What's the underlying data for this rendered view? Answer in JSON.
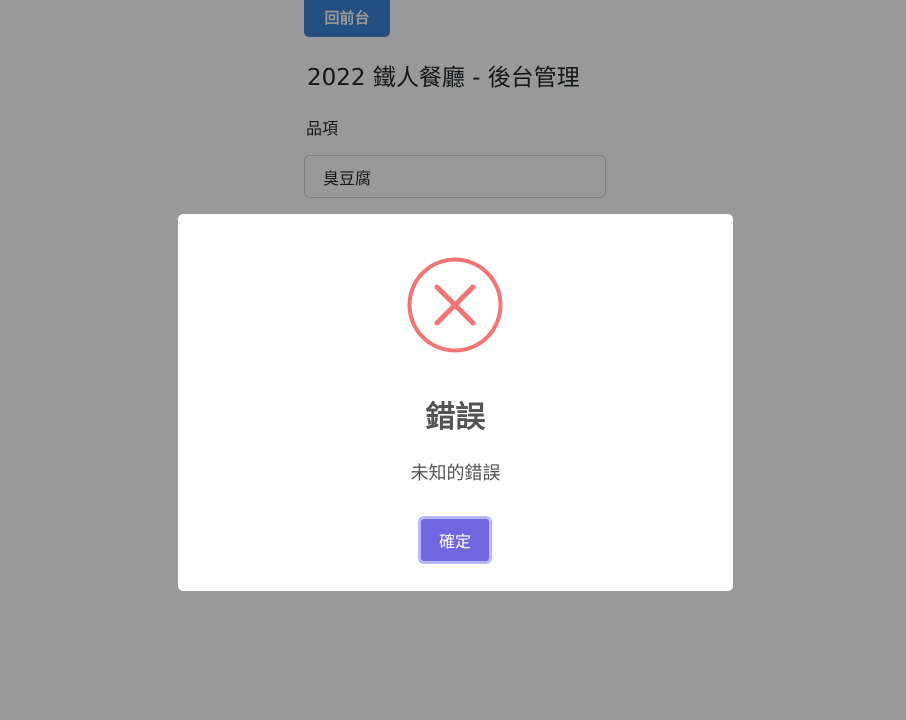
{
  "page": {
    "back_button_label": "回前台",
    "title": "2022 鐵人餐廳 - 後台管理",
    "field_label": "品項",
    "field_value": "臭豆腐"
  },
  "dialog": {
    "icon": "error-x-icon",
    "title": "錯誤",
    "text": "未知的錯誤",
    "confirm_label": "確定"
  },
  "colors": {
    "primary_button": "#3b82d6",
    "error_icon": "#f27474",
    "confirm_button": "#7066e0",
    "confirm_button_focus_ring": "#bcb6f6"
  }
}
